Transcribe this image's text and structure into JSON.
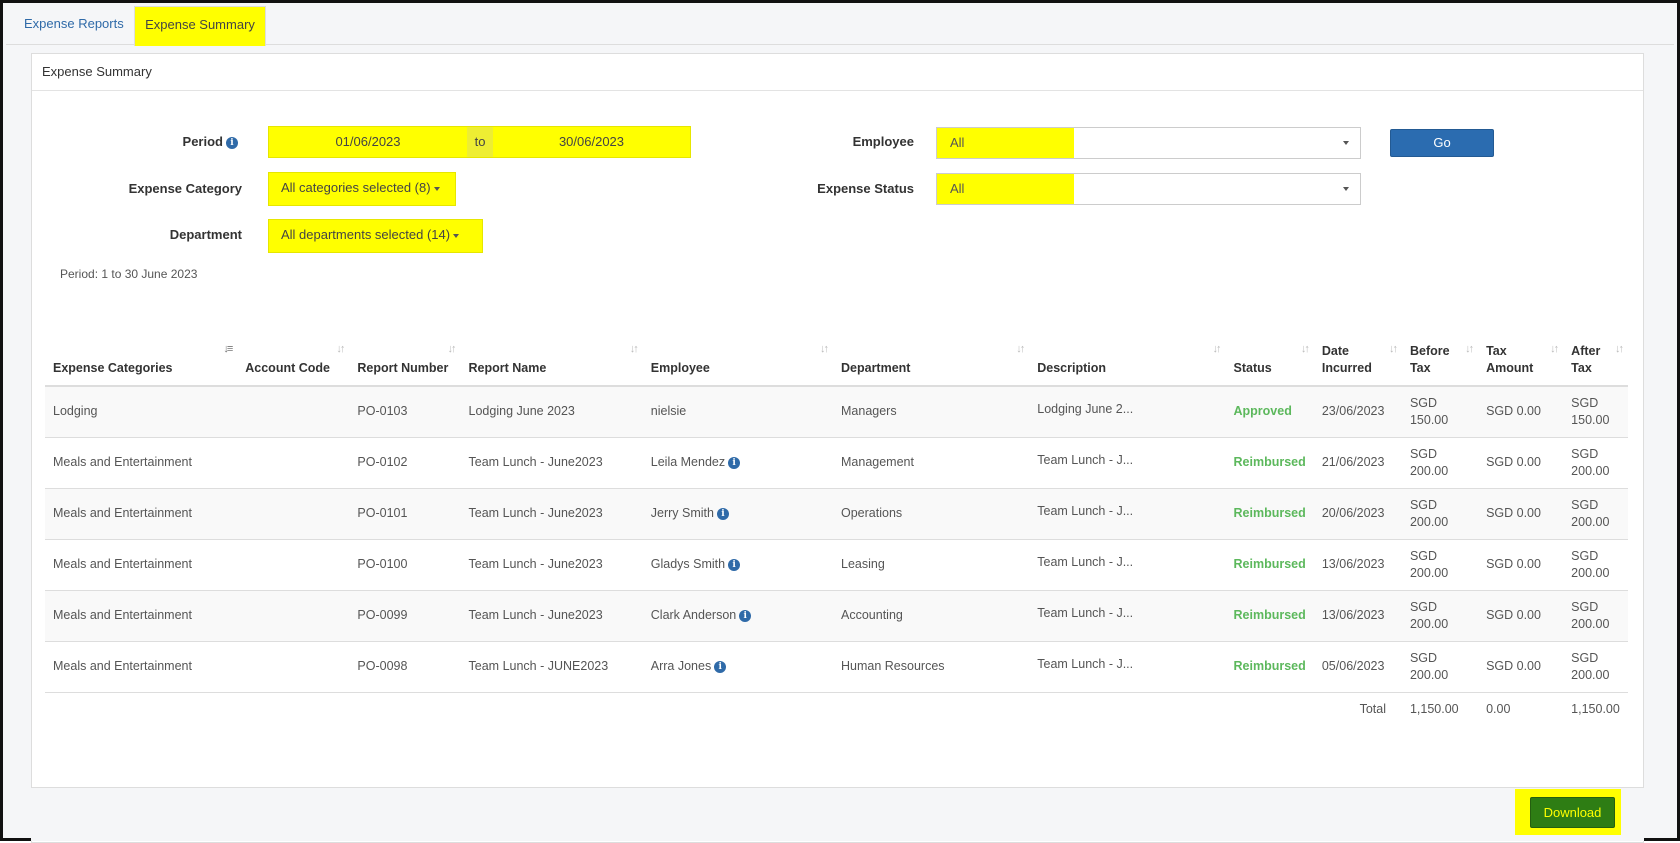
{
  "tabs": [
    {
      "label": "Expense Reports"
    },
    {
      "label": "Expense Summary"
    }
  ],
  "panel": {
    "title": "Expense Summary"
  },
  "filters": {
    "period_label": "Period",
    "period_from": "01/06/2023",
    "period_to_word": "to",
    "period_to": "30/06/2023",
    "category_label": "Expense Category",
    "category_value": "All categories selected (8)",
    "department_label": "Department",
    "department_value": "All departments selected (14)",
    "employee_label": "Employee",
    "employee_value": "All",
    "status_label": "Expense Status",
    "status_value": "All",
    "go_label": "Go",
    "period_text": "Period: 1 to 30 June 2023"
  },
  "table": {
    "headers": [
      "Expense Categories",
      "Account Code",
      "Report Number",
      "Report Name",
      "Employee",
      "Department",
      "Description",
      "Status",
      "Date Incurred",
      "Before Tax",
      "Tax Amount",
      "After Tax"
    ],
    "rows": [
      {
        "category": "Lodging",
        "account": "",
        "number": "PO-0103",
        "name": "Lodging June 2023",
        "employee": "nielsie",
        "info": false,
        "department": "Managers",
        "description": "Lodging June 2...",
        "status": "Approved",
        "date": "23/06/2023",
        "before": "SGD 150.00",
        "tax": "SGD 0.00",
        "after": "SGD 150.00"
      },
      {
        "category": "Meals and Entertainment",
        "account": "",
        "number": "PO-0102",
        "name": "Team Lunch - June2023",
        "employee": "Leila Mendez",
        "info": true,
        "department": "Management",
        "description": "Team Lunch - J...",
        "status": "Reimbursed",
        "date": "21/06/2023",
        "before": "SGD 200.00",
        "tax": "SGD 0.00",
        "after": "SGD 200.00"
      },
      {
        "category": "Meals and Entertainment",
        "account": "",
        "number": "PO-0101",
        "name": "Team Lunch - June2023",
        "employee": "Jerry Smith",
        "info": true,
        "department": "Operations",
        "description": "Team Lunch - J...",
        "status": "Reimbursed",
        "date": "20/06/2023",
        "before": "SGD 200.00",
        "tax": "SGD 0.00",
        "after": "SGD 200.00"
      },
      {
        "category": "Meals and Entertainment",
        "account": "",
        "number": "PO-0100",
        "name": "Team Lunch - June2023",
        "employee": "Gladys Smith",
        "info": true,
        "department": "Leasing",
        "description": "Team Lunch - J...",
        "status": "Reimbursed",
        "date": "13/06/2023",
        "before": "SGD 200.00",
        "tax": "SGD 0.00",
        "after": "SGD 200.00"
      },
      {
        "category": "Meals and Entertainment",
        "account": "",
        "number": "PO-0099",
        "name": "Team Lunch - June2023",
        "employee": "Clark Anderson",
        "info": true,
        "department": "Accounting",
        "description": "Team Lunch - J...",
        "status": "Reimbursed",
        "date": "13/06/2023",
        "before": "SGD 200.00",
        "tax": "SGD 0.00",
        "after": "SGD 200.00"
      },
      {
        "category": "Meals and Entertainment",
        "account": "",
        "number": "PO-0098",
        "name": "Team Lunch - JUNE2023",
        "employee": "Arra Jones",
        "info": true,
        "department": "Human Resources",
        "description": "Team Lunch - J...",
        "status": "Reimbursed",
        "date": "05/06/2023",
        "before": "SGD 200.00",
        "tax": "SGD 0.00",
        "after": "SGD 200.00"
      }
    ],
    "total": {
      "label": "Total",
      "before": "1,150.00",
      "tax": "0.00",
      "after": "1,150.00"
    }
  },
  "footer": {
    "download_label": "Download"
  },
  "colors": {
    "highlight": "#ffff00",
    "primary": "#2b6cb0",
    "success": "#5cb85c",
    "download_bg": "#2e7d14"
  },
  "icons": {
    "info": "info-circle-icon",
    "sort": "sort-icon",
    "caret": "caret-down-icon"
  }
}
